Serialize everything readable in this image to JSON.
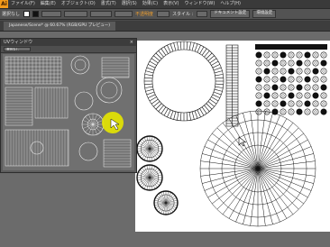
{
  "app": {
    "logo": "Ai"
  },
  "menubar": {
    "items": [
      "ファイル(F)",
      "編集(E)",
      "オブジェクト(O)",
      "書式(T)",
      "選択(S)",
      "効果(C)",
      "表示(V)",
      "ウィンドウ(W)",
      "ヘルプ(H)"
    ]
  },
  "controlbar": {
    "selection_label": "選択なし",
    "opacity_label": "不透明度",
    "style_label": "スタイル :",
    "doc_settings_button": "ドキュメント設定",
    "preferences_button": "環境設定"
  },
  "document_tab": {
    "title": "Japanese/Scene* @ 60.67% (RGB/GPU プレビュー)"
  },
  "uv_window": {
    "title": "UVウィンドウ",
    "close_glyph": "×",
    "option_label": "選択なし"
  },
  "colors": {
    "app_logo": "#f29a1a",
    "highlight": "#e6e600",
    "artboard": "#ffffff",
    "workspace": "#6b6b6b"
  },
  "icons": [
    "close-icon",
    "cursor-icon"
  ]
}
